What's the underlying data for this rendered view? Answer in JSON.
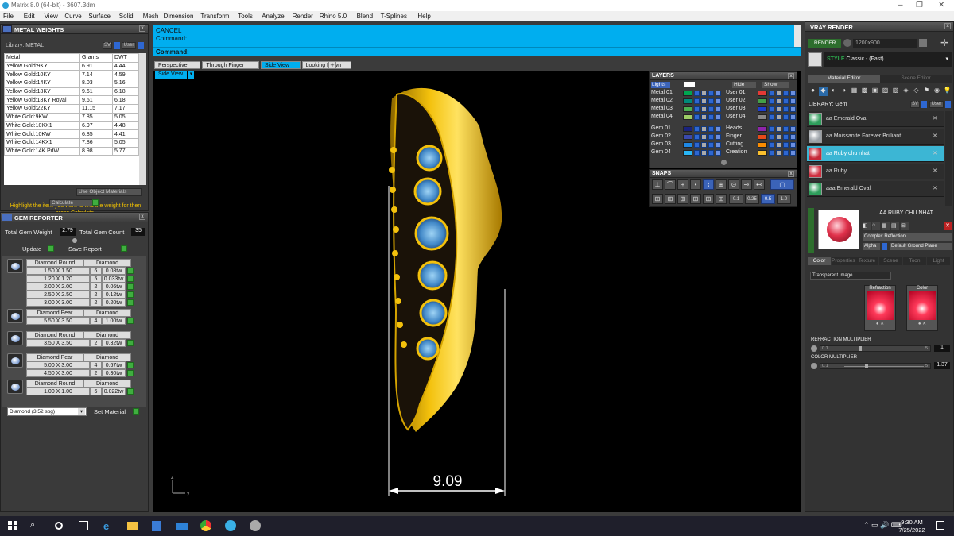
{
  "window": {
    "title": "Matrix 8.0 (64-bit) - 3607.3dm"
  },
  "menu": [
    "File",
    "Edit",
    "View",
    "Curve",
    "Surface",
    "Solid",
    "Mesh",
    "Dimension",
    "Transform",
    "Tools",
    "Analyze",
    "Render",
    "Rhino 5.0",
    "Blend",
    "T-Splines",
    "Help"
  ],
  "metal_weights": {
    "title": "METAL WEIGHTS",
    "library_label": "Library: METAL",
    "sv_label": "SV",
    "user_label": "User",
    "columns": [
      "Metal",
      "Grams",
      "DWT"
    ],
    "rows": [
      [
        "Yellow Gold:9KY",
        "6.91",
        "4.44"
      ],
      [
        "Yellow Gold:10KY",
        "7.14",
        "4.59"
      ],
      [
        "Yellow Gold:14KY",
        "8.03",
        "5.16"
      ],
      [
        "Yellow Gold:18KY",
        "9.61",
        "6.18"
      ],
      [
        "Yellow Gold:18KY Royal",
        "9.61",
        "6.18"
      ],
      [
        "Yellow Gold:22KY",
        "11.15",
        "7.17"
      ],
      [
        "White Gold:9KW",
        "7.85",
        "5.05"
      ],
      [
        "White Gold:10KX1",
        "6.97",
        "4.48"
      ],
      [
        "White Gold:10KW",
        "6.85",
        "4.41"
      ],
      [
        "White Gold:14KX1",
        "7.86",
        "5.05"
      ],
      [
        "White Gold:14K PdW",
        "8.98",
        "5.77"
      ]
    ],
    "use_object_materials": "Use Object Materials",
    "hint": "Highlight the item you want to find the weight for then press Calculate.",
    "calculate": "Calculate"
  },
  "gem_reporter": {
    "title": "GEM REPORTER",
    "total_weight_label": "Total Gem Weight",
    "total_weight": "2.79",
    "total_count_label": "Total Gem Count",
    "total_count": "35",
    "update": "Update",
    "save_report": "Save Report",
    "groups": [
      {
        "shape": "Diamond Round",
        "material": "Diamond",
        "rows": [
          [
            "1.50 X 1.50",
            "6",
            "0.08tw"
          ],
          [
            "1.20 X 1.20",
            "5",
            "0.033tw"
          ],
          [
            "2.00 X 2.00",
            "2",
            "0.06tw"
          ],
          [
            "2.50 X 2.50",
            "2",
            "0.12tw"
          ],
          [
            "3.00 X 3.00",
            "2",
            "0.20tw"
          ]
        ]
      },
      {
        "shape": "Diamond Pear",
        "material": "Diamond",
        "rows": [
          [
            "5.50 X 3.50",
            "4",
            "1.00tw"
          ]
        ]
      },
      {
        "shape": "Diamond Round",
        "material": "Diamond",
        "rows": [
          [
            "3.50 X 3.50",
            "2",
            "0.32tw"
          ]
        ]
      },
      {
        "shape": "Diamond Pear",
        "material": "Diamond",
        "rows": [
          [
            "5.00 X 3.00",
            "4",
            "0.67tw"
          ],
          [
            "4.50 X 3.00",
            "2",
            "0.30tw"
          ]
        ]
      },
      {
        "shape": "Diamond Round",
        "material": "Diamond",
        "rows": [
          [
            "1.00 X 1.00",
            "6",
            "0.022tw"
          ]
        ]
      }
    ],
    "material_select": "Diamond   (3.52 spg)",
    "set_material": "Set Material"
  },
  "command": {
    "line1": "CANCEL",
    "line2": "Command:",
    "prompt": "Command:"
  },
  "view_tabs": [
    "Perspective",
    "Through Finger",
    "Side View",
    "Looking Down"
  ],
  "active_tab": "Side View",
  "viewport": {
    "label": "Side View",
    "dimension": "9.09",
    "axis_z": "z",
    "axis_y": "y"
  },
  "layers": {
    "title": "LAYERS",
    "lights": "Lights",
    "hide": "Hide",
    "show": "Show",
    "left": [
      {
        "name": "Metal 01",
        "color": "#00a650"
      },
      {
        "name": "Metal 02",
        "color": "#008b7a"
      },
      {
        "name": "Metal 03",
        "color": "#4caf50"
      },
      {
        "name": "Metal 04",
        "color": "#9ccc65"
      },
      {
        "name": "Gem 01",
        "color": "#1a237e"
      },
      {
        "name": "Gem 02",
        "color": "#3949ab"
      },
      {
        "name": "Gem 03",
        "color": "#1e88e5"
      },
      {
        "name": "Gem 04",
        "color": "#29b6f6"
      }
    ],
    "right": [
      {
        "name": "User 01",
        "color": "#e53935"
      },
      {
        "name": "User 02",
        "color": "#43a047"
      },
      {
        "name": "User 03",
        "color": "#1e3fcf"
      },
      {
        "name": "User 04",
        "color": "#888888"
      },
      {
        "name": "Heads",
        "color": "#8e24aa"
      },
      {
        "name": "Finger",
        "color": "#e64a19"
      },
      {
        "name": "Cutting",
        "color": "#fb8c00"
      },
      {
        "name": "Creation",
        "color": "#fbc02d"
      }
    ]
  },
  "snaps": {
    "title": "SNAPS",
    "values": [
      "0.1",
      "0.25",
      "0.5",
      "1.0"
    ]
  },
  "vray": {
    "title": "VRAY RENDER",
    "render": "RENDER",
    "resolution": "1200x900",
    "style_label": "STYLE",
    "style_value": "Classic - (Fast)",
    "tabs": [
      "Material Editor",
      "Scene Editor"
    ],
    "library": "LIBRARY: Gem",
    "sv_label": "SV",
    "user_label": "User",
    "materials": [
      {
        "name": "aa Emerald Oval",
        "color": "#2e9e5b"
      },
      {
        "name": "aa Moissanite Forever Brilliant",
        "color": "#9aa0a6"
      },
      {
        "name": "aa Ruby chu nhat",
        "color": "#c62838"
      },
      {
        "name": "aa Ruby",
        "color": "#d03040"
      },
      {
        "name": "aaa Emerald Oval",
        "color": "#2e9e5b"
      }
    ],
    "selected_material": "aa Ruby chu nhat",
    "preview_name": "AA RUBY CHU NHAT",
    "reflection": "Complex Reflection",
    "alpha_label": "Alpha",
    "ground": "Default Ground Plane",
    "prop_tabs": [
      "Color",
      "Properties",
      "Texture",
      "Scene",
      "Toon",
      "Light"
    ],
    "transparent_select": "Transparent Image",
    "refraction_label": "Refraction",
    "color_label": "Color",
    "refraction_multiplier_label": "REFRACTION MULTIPLIER",
    "refraction_min": "0.1",
    "refraction_max": "5",
    "refraction_value": "1",
    "color_multiplier_label": "COLOR MULTIPLIER",
    "color_min": "0.1",
    "color_max": "5",
    "color_value": "1.37"
  },
  "taskbar": {
    "time": "9:30 AM",
    "date": "7/25/2022"
  }
}
